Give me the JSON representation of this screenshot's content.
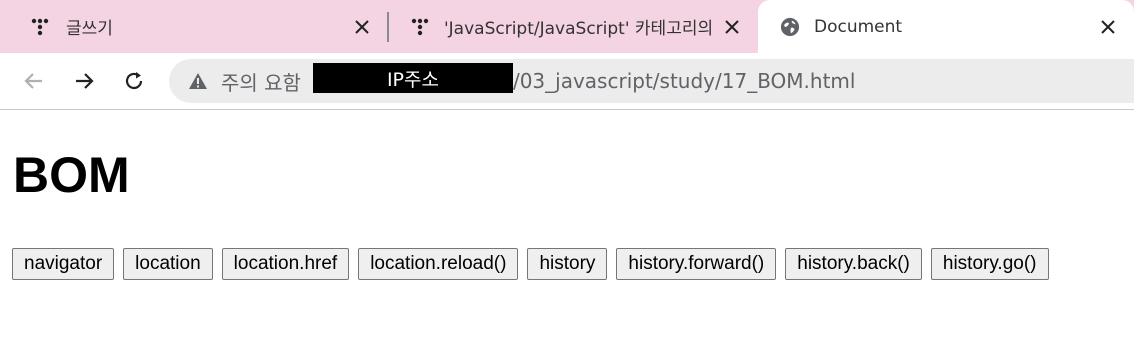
{
  "browser": {
    "tabs": [
      {
        "title": "글쓰기",
        "icon": "tistory-icon",
        "active": false
      },
      {
        "title": "'JavaScript/JavaScript' 카테고리의",
        "icon": "tistory-icon",
        "active": false
      },
      {
        "title": "Document",
        "icon": "globe-icon",
        "active": true
      }
    ],
    "close_glyph": "✕",
    "omnibox": {
      "security_label": "주의 요함",
      "redacted_label": "IP주소",
      "url_path": "/03_javascript/study/17_BOM.html"
    },
    "colors": {
      "tabstrip": "#f4d4e3",
      "omnibox": "#ececec"
    }
  },
  "page": {
    "heading": "BOM",
    "buttons": [
      "navigator",
      "location",
      "location.href",
      "location.reload()",
      "history",
      "history.forward()",
      "history.back()",
      "history.go()"
    ]
  }
}
